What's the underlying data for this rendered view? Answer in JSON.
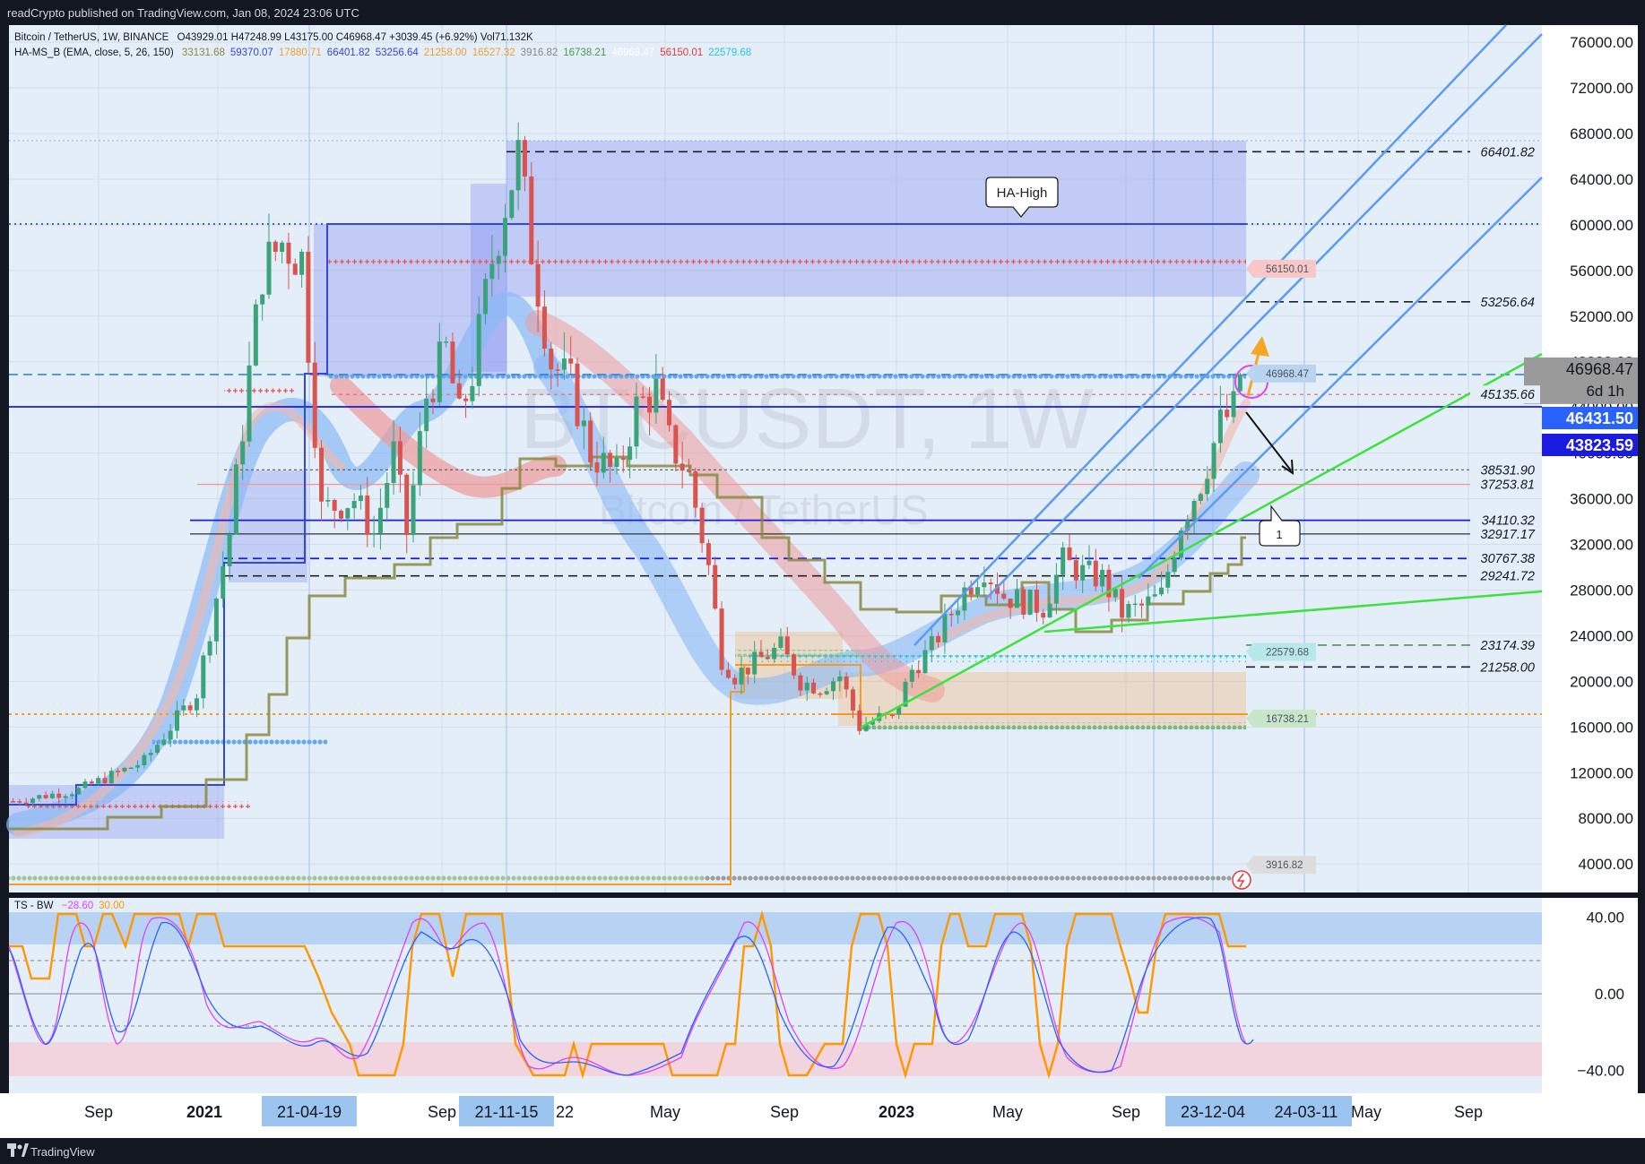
{
  "header": {
    "published": "readCrypto published on TradingView.com, Jan 08, 2024 23:06 UTC",
    "symbol_line": {
      "name": "Bitcoin / TetherUS, 1W, BINANCE",
      "ohlc": "O43929.01 H47248.99 L43175.00 C46968.47 +3039.45 (+6.92%) Vol71.132K"
    },
    "indicator_line": {
      "name": "HA-MS_B (EMA, close, 5, 26, 150)",
      "values": [
        {
          "text": "33131.68",
          "color": "#8a8a40"
        },
        {
          "text": "59370.07",
          "color": "#3148d8"
        },
        {
          "text": "17880.71",
          "color": "#f0a030"
        },
        {
          "text": "66401.82",
          "color": "#3148d8"
        },
        {
          "text": "53256.64",
          "color": "#3148d8"
        },
        {
          "text": "21258.00",
          "color": "#f0a030"
        },
        {
          "text": "16527.32",
          "color": "#f0a030"
        },
        {
          "text": "3916.82",
          "color": "#888888"
        },
        {
          "text": "16738.21",
          "color": "#43a047"
        },
        {
          "text": "46968.47",
          "color": "#ffffff"
        },
        {
          "text": "56150.01",
          "color": "#e53935"
        },
        {
          "text": "22579.68",
          "color": "#26c6da"
        }
      ]
    },
    "oscillator_line": {
      "name": "TS - BW",
      "values": [
        {
          "text": "−28.60",
          "color": "#e040fb"
        },
        {
          "text": "30.00",
          "color": "#ff9800"
        }
      ]
    }
  },
  "footer": {
    "brand": "TradingView"
  },
  "watermark": {
    "symbol": "BTCUSDT, 1W",
    "name": "Bitcoin / TetherUS"
  },
  "chart_data": [
    {
      "type": "line",
      "title": "Bitcoin / TetherUS, 1W, BINANCE",
      "y_axis_ticks": [
        4000,
        8000,
        12000,
        16000,
        20000,
        24000,
        28000,
        32000,
        36000,
        40000,
        44000,
        48000,
        52000,
        56000,
        60000,
        64000,
        68000,
        72000,
        76000
      ],
      "y_axis_labels": [
        "4000.00",
        "8000.00",
        "12000.00",
        "16000.00",
        "20000.00",
        "24000.00",
        "28000.00",
        "32000.00",
        "36000.00",
        "40000.00",
        "44000.00",
        "48000.00",
        "52000.00",
        "56000.00",
        "60000.00",
        "64000.00",
        "68000.00",
        "72000.00",
        "76000.00"
      ],
      "ylim": [
        1500,
        77500
      ],
      "x_axis_labels": [
        "Sep",
        "2021",
        "Sep",
        "22",
        "May",
        "Sep",
        "2023",
        "May",
        "Sep",
        "May",
        "Sep"
      ],
      "highlighted_dates": [
        "21-04-19",
        "21-11-15",
        "23-12-04",
        "24-03-11"
      ],
      "price_labels": [
        {
          "text": "46968.47",
          "sub": "6d 1h",
          "value": 46968.47,
          "color": "#9a9a9a"
        },
        {
          "text": "46431.50",
          "value": 46431.5,
          "color": "#2962ff"
        },
        {
          "text": "43823.59",
          "value": 43823.59,
          "color": "#1a1ae0"
        }
      ],
      "levels": [
        {
          "label": "66401.82",
          "value": 66401.82,
          "style": "dashed-black"
        },
        {
          "label": "53256.64",
          "value": 53256.64,
          "style": "dashed-black"
        },
        {
          "label": "45135.66",
          "value": 45135.66,
          "style": "dashed-red"
        },
        {
          "label": "38531.90",
          "value": 38531.9,
          "style": "dashed-gray"
        },
        {
          "label": "37253.81",
          "value": 37253.81,
          "style": "solid-red"
        },
        {
          "label": "34110.32",
          "value": 34110.32,
          "style": "solid-blue"
        },
        {
          "label": "32917.17",
          "value": 32917.17,
          "style": "solid-black"
        },
        {
          "label": "30767.38",
          "value": 30767.38,
          "style": "dashed-blue"
        },
        {
          "label": "29241.72",
          "value": 29241.72,
          "style": "dashed-black"
        },
        {
          "label": "23174.39",
          "value": 23174.39,
          "style": "dashed-green"
        },
        {
          "label": "21258.00",
          "value": 21258.0,
          "style": "dashed-black"
        }
      ],
      "tags": [
        {
          "text": "56150.01",
          "value": 56150.01,
          "color": "#f8c8c8"
        },
        {
          "text": "46968.47",
          "value": 46968.47,
          "color": "#b8d4f0"
        },
        {
          "text": "22579.68",
          "value": 22579.68,
          "color": "#b8e8ec"
        },
        {
          "text": "16738.21",
          "value": 16738.21,
          "color": "#c8e6c9"
        },
        {
          "text": "3916.82",
          "value": 3916.82,
          "color": "#dcdcdc"
        }
      ],
      "annotations": [
        "HA-High",
        "1"
      ],
      "watermark": "BTCUSDT, 1W",
      "close_path": [
        [
          0,
          9500
        ],
        [
          10,
          10500
        ],
        [
          20,
          13000
        ],
        [
          28,
          19000
        ],
        [
          33,
          33000
        ],
        [
          36,
          47000
        ],
        [
          38,
          56000
        ],
        [
          41,
          58500
        ],
        [
          44,
          57000
        ],
        [
          47,
          35000
        ],
        [
          52,
          36000
        ],
        [
          55,
          33000
        ],
        [
          58,
          40000
        ],
        [
          60,
          33000
        ],
        [
          63,
          45000
        ],
        [
          66,
          49000
        ],
        [
          68,
          43000
        ],
        [
          70,
          47000
        ],
        [
          73,
          57000
        ],
        [
          75,
          62000
        ],
        [
          77,
          66000
        ],
        [
          79,
          58000
        ],
        [
          82,
          48000
        ],
        [
          85,
          46000
        ],
        [
          88,
          40000
        ],
        [
          92,
          38000
        ],
        [
          95,
          44000
        ],
        [
          98,
          45500
        ],
        [
          100,
          41000
        ],
        [
          103,
          38000
        ],
        [
          106,
          30000
        ],
        [
          108,
          22000
        ],
        [
          110,
          20500
        ],
        [
          114,
          22000
        ],
        [
          117,
          23000
        ],
        [
          120,
          20000
        ],
        [
          123,
          19500
        ],
        [
          126,
          20500
        ],
        [
          129,
          16000
        ],
        [
          132,
          16800
        ],
        [
          134,
          16700
        ],
        [
          137,
          21000
        ],
        [
          140,
          23000
        ],
        [
          142,
          25000
        ],
        [
          145,
          28000
        ],
        [
          148,
          30000
        ],
        [
          151,
          27500
        ],
        [
          154,
          27000
        ],
        [
          157,
          26500
        ],
        [
          160,
          30500
        ],
        [
          163,
          29500
        ],
        [
          166,
          29000
        ],
        [
          169,
          26000
        ],
        [
          172,
          26500
        ],
        [
          175,
          27500
        ],
        [
          178,
          34000
        ],
        [
          181,
          37500
        ],
        [
          184,
          42500
        ],
        [
          186,
          43800
        ],
        [
          187,
          46968
        ]
      ]
    },
    {
      "type": "line",
      "title": "TS - BW",
      "y_axis_labels": [
        "40.00",
        "0.00",
        "−40.00"
      ],
      "y_axis_ticks": [
        40,
        0,
        -40
      ],
      "ylim": [
        -52,
        50
      ],
      "series": [
        {
          "name": "−28.60",
          "color": "#2962ff",
          "last": -28.6
        },
        {
          "name": "30.00",
          "color": "#ff9800",
          "last": 30.0
        }
      ]
    }
  ]
}
